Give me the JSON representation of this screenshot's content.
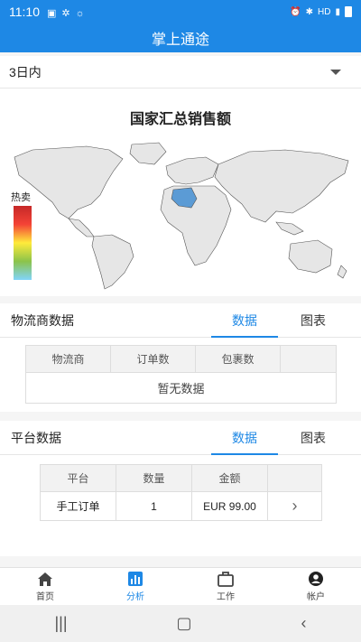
{
  "status_bar": {
    "time": "11:10",
    "right_text": "HD"
  },
  "app": {
    "title": "掌上通途"
  },
  "filter": {
    "selected": "3日内"
  },
  "map": {
    "title": "国家汇总销售额",
    "legend_label": "热卖",
    "highlight_color": "#5b9bd5"
  },
  "logistics": {
    "title": "物流商数据",
    "tabs": [
      "数据",
      "图表"
    ],
    "columns": [
      "物流商",
      "订单数",
      "包裹数",
      ""
    ],
    "empty_text": "暂无数据"
  },
  "platform": {
    "title": "平台数据",
    "tabs": [
      "数据",
      "图表"
    ],
    "columns": [
      "平台",
      "数量",
      "金额",
      ""
    ],
    "rows": [
      {
        "platform": "手工订单",
        "qty": "1",
        "amount": "EUR 99.00",
        "action": "›"
      }
    ]
  },
  "bottom_nav": [
    {
      "label": "首页",
      "icon": "home-icon"
    },
    {
      "label": "分析",
      "icon": "analytics-icon"
    },
    {
      "label": "工作",
      "icon": "briefcase-icon"
    },
    {
      "label": "帐户",
      "icon": "account-icon"
    }
  ],
  "colors": {
    "primary": "#1e88e5"
  }
}
